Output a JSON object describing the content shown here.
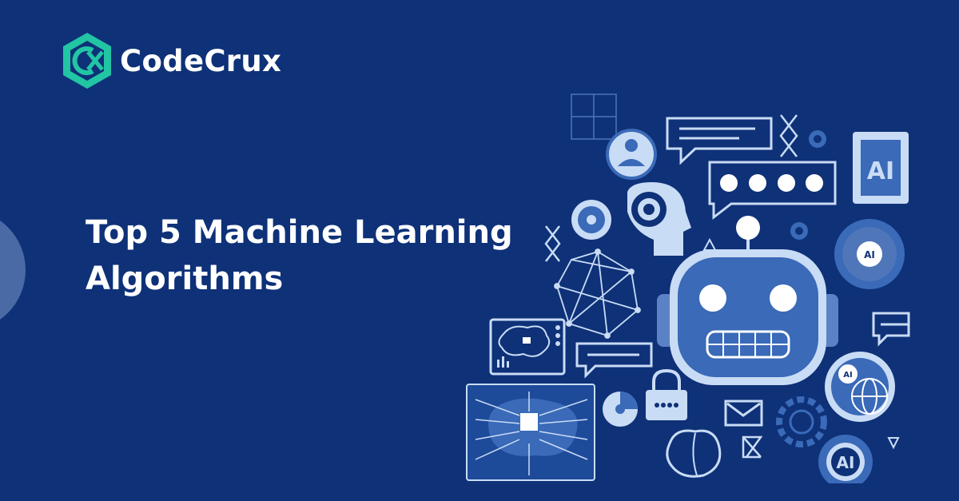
{
  "brand": {
    "name": "CodeCrux",
    "icon": "codecrux-hexagon-logo",
    "accent_color": "#22c5a4"
  },
  "headline": {
    "line1": "Top 5 Machine Learning",
    "line2": "Algorithms"
  },
  "illustration": {
    "ai_badge_1": "AI",
    "ai_badge_2": "AI",
    "ai_badge_3": "AI",
    "ai_badge_4": "AI"
  },
  "colors": {
    "background": "#0e3178",
    "text": "#ffffff",
    "illustration_fill": "#3a6ab8",
    "illustration_light": "#c9dcf5"
  }
}
